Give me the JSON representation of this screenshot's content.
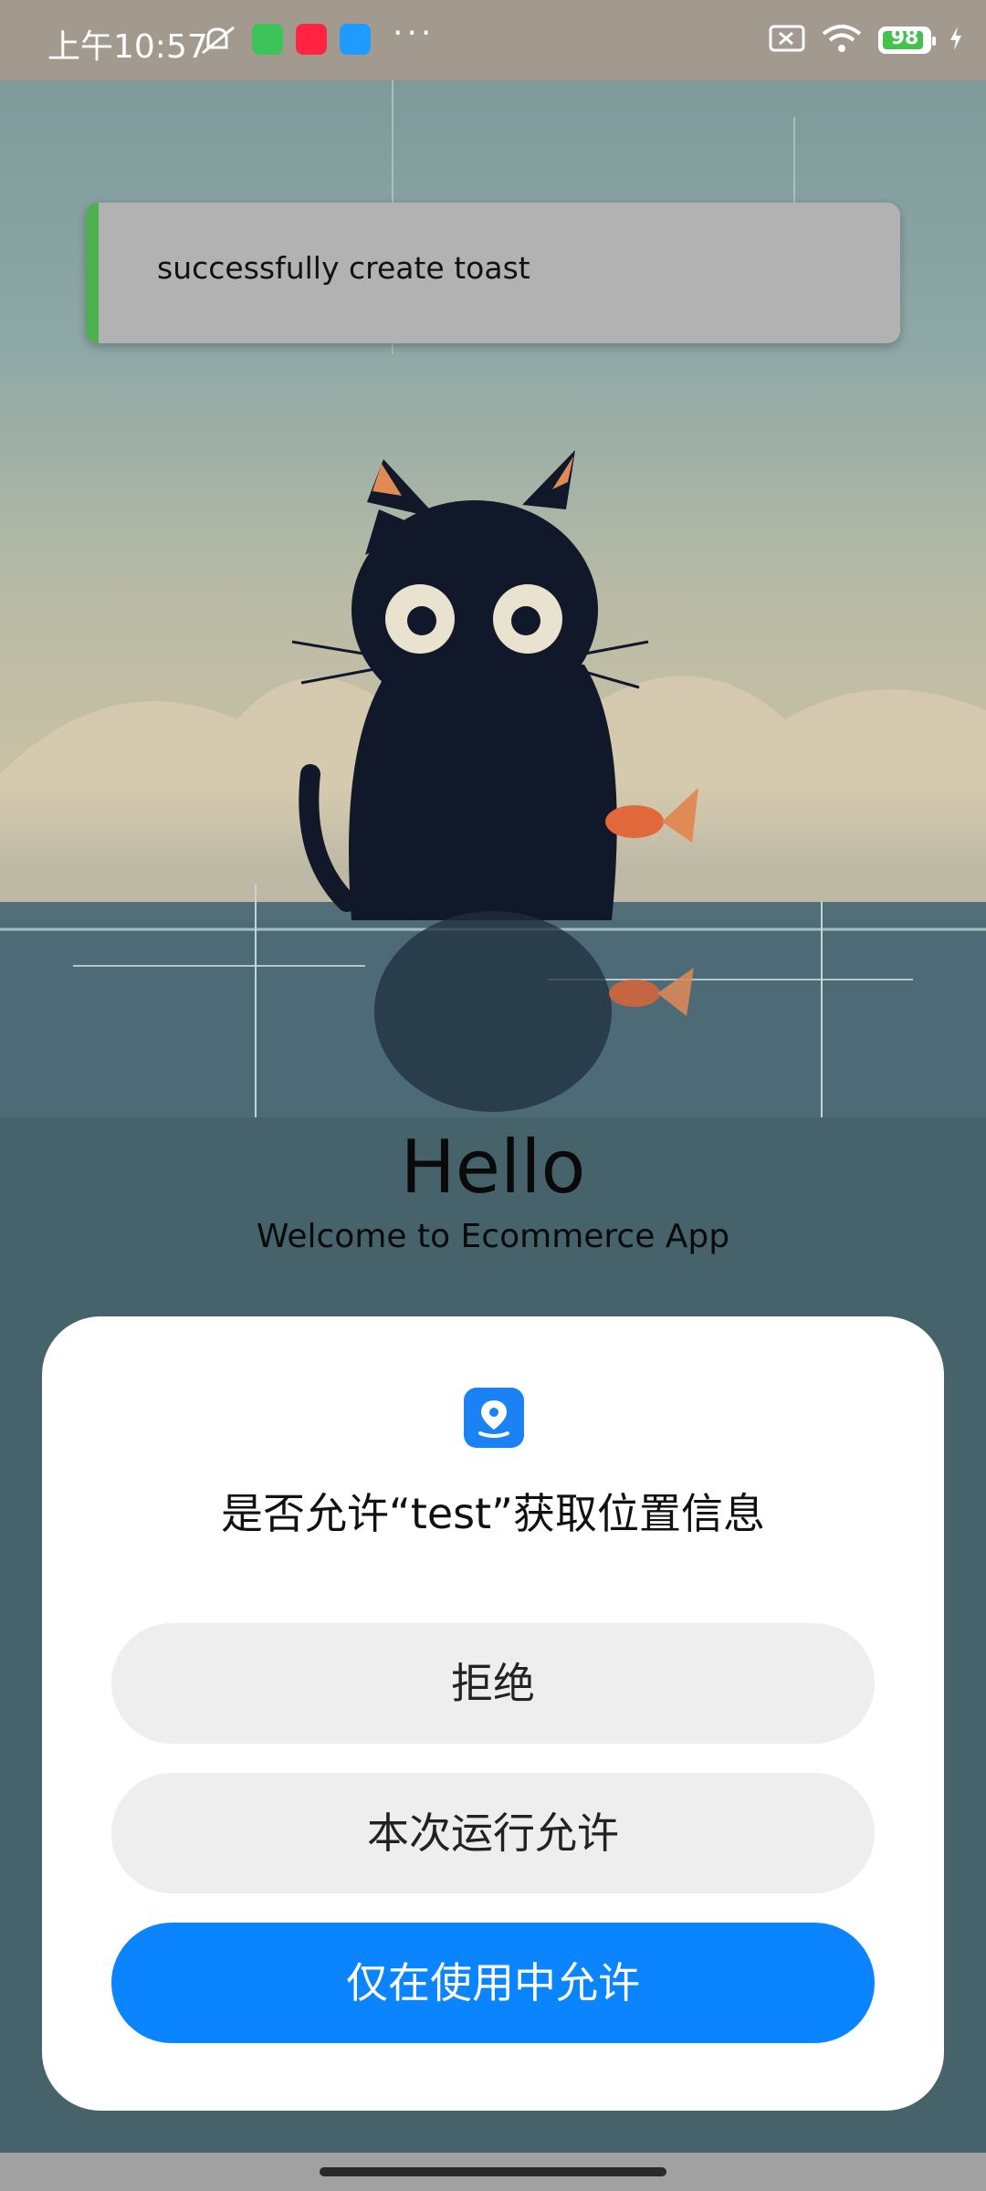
{
  "status_bar": {
    "time": "上午10:57",
    "battery": "98",
    "icons": [
      "mute-icon",
      "wechat-icon",
      "xiaohongshu-icon",
      "chat-icon",
      "more-dots-icon",
      "sim-off-icon",
      "wifi-icon",
      "battery-icon",
      "charging-icon"
    ]
  },
  "toast": {
    "message": "successfully create toast",
    "accent_color": "#4caf50"
  },
  "main": {
    "title": "Hello",
    "subtitle": "Welcome to Ecommerce App"
  },
  "permission_dialog": {
    "icon": "location-pin-icon",
    "title": "是否允许“test”获取位置信息",
    "buttons": {
      "deny": "拒绝",
      "allow_once": "本次运行允许",
      "allow_while_using": "仅在使用中允许"
    },
    "primary_color": "#0b84ff"
  }
}
